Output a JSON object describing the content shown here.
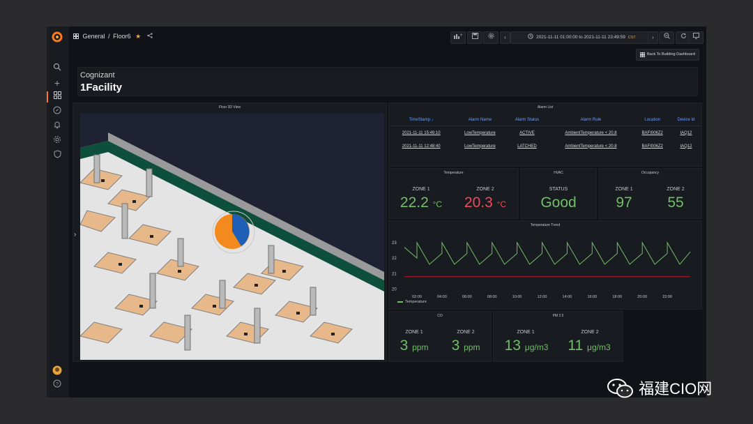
{
  "topbar": {
    "breadcrumb_folder": "General",
    "breadcrumb_sep": "/",
    "breadcrumb_dashboard": "Floor6",
    "time_range": "2021-11-11 01:00:00 to 2021-11-11 23:49:59",
    "timezone": "CST",
    "back_button": "Back To Building Dashboard"
  },
  "header": {
    "company": "Cognizant",
    "facility": "1Facility"
  },
  "floor_view": {
    "title": "Floor 3D View"
  },
  "alarm_list": {
    "title": "Alarm List",
    "columns": [
      "TimeStamp ↓",
      "Alarm Name",
      "Alarm Status",
      "Alarm Rule",
      "Location",
      "Device Id"
    ],
    "rows": [
      [
        "2021-11-11 15:49:10",
        "LowTemperature",
        "ACTIVE",
        "AmbientTemperature < 20.8",
        "BAFI006Z2",
        "IAQ12"
      ],
      [
        "2021-11-11 12:48:40",
        "LowTemperature",
        "LATCHED",
        "AmbientTemperature < 20.8",
        "BAFI006Z2",
        "IAQ12"
      ]
    ]
  },
  "temperature": {
    "title": "Temperature",
    "zone1_label": "ZONE 1",
    "zone1_value": "22.2",
    "zone2_label": "ZONE 2",
    "zone2_value": "20.3",
    "unit": "°C"
  },
  "hvac": {
    "title": "HVAC",
    "label": "STATUS",
    "value": "Good"
  },
  "occupancy": {
    "title": "Occupancy",
    "zone1_label": "ZONE 1",
    "zone1_value": "97",
    "zone2_label": "ZONE 2",
    "zone2_value": "55"
  },
  "co": {
    "title": "CO",
    "zone1_label": "ZONE 1",
    "zone1_value": "3",
    "zone2_label": "ZONE 2",
    "zone2_value": "3",
    "unit": "ppm"
  },
  "pm25": {
    "title": "PM 2.5",
    "zone1_label": "ZONE 1",
    "zone1_value": "13",
    "zone2_label": "ZONE 2",
    "zone2_value": "11",
    "unit": "μg/m3"
  },
  "colors": {
    "accent": "#ff7a1a",
    "good": "#73bf69",
    "bad": "#f2495c",
    "link": "#6e9fff",
    "threshold": "#c4162a"
  },
  "chart_data": {
    "type": "line",
    "title": "Temperature Trend",
    "x": [
      "01:00",
      "02:00",
      "02:00",
      "03:00",
      "04:00",
      "04:00",
      "05:00",
      "06:00",
      "06:00",
      "07:00",
      "08:00",
      "08:00",
      "09:00",
      "10:00",
      "10:00",
      "11:00",
      "12:00",
      "12:00",
      "13:00",
      "14:00",
      "14:00",
      "15:00",
      "16:00",
      "16:00",
      "17:00",
      "18:00",
      "18:00",
      "19:00",
      "20:00",
      "20:00",
      "21:00",
      "22:00",
      "22:00",
      "23:00",
      "23:50"
    ],
    "series": [
      {
        "name": "Temperature",
        "color": "#73bf69",
        "values": [
          22.7,
          22.0,
          23.0,
          21.6,
          22.3,
          23.0,
          21.6,
          22.3,
          23.0,
          21.6,
          22.3,
          23.0,
          21.6,
          22.3,
          23.0,
          21.6,
          22.3,
          23.0,
          21.6,
          22.3,
          23.0,
          21.6,
          22.3,
          23.0,
          21.6,
          22.3,
          23.0,
          21.6,
          22.3,
          23.0,
          21.6,
          22.3,
          23.0,
          21.6,
          22.4
        ]
      }
    ],
    "threshold": 20.8,
    "yticks": [
      20,
      21,
      22,
      23
    ],
    "xticks": [
      "02:00",
      "04:00",
      "06:00",
      "08:00",
      "10:00",
      "12:00",
      "14:00",
      "16:00",
      "18:00",
      "20:00",
      "22:00"
    ],
    "xrange": [
      "01:00",
      "23:50"
    ],
    "ylim": [
      19.8,
      23.4
    ],
    "legend": "bottom-left",
    "grid": false
  }
}
